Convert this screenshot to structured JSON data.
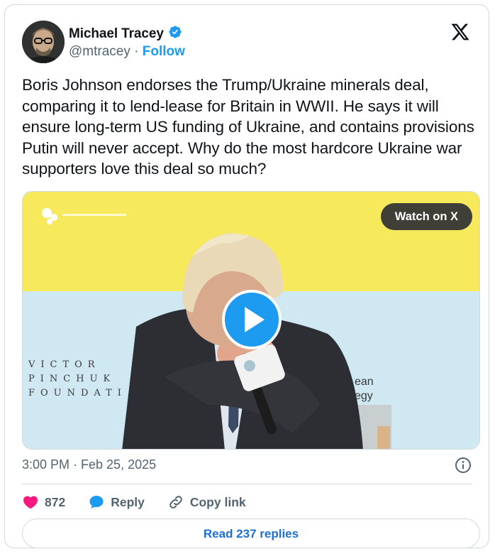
{
  "author": {
    "name": "Michael Tracey",
    "handle": "@mtracey",
    "separator": "·",
    "follow_label": "Follow",
    "verified": true
  },
  "tweet": {
    "text": "Boris Johnson endorses the Trump/Ukraine minerals deal, comparing it to lend-lease for Britain in WWII. He says it will ensure long-term US funding of Ukraine, and contains provisions Putin will never accept. Why do the most hardcore Ukraine war supporters love this deal so much?"
  },
  "media": {
    "watch_label": "Watch on X",
    "foundation_lines": [
      "VICTOR",
      "PINCHUK",
      "FOUNDATI"
    ],
    "banner_fragment_lines": [
      "ean",
      "egy"
    ]
  },
  "meta": {
    "timestamp": "3:00 PM · Feb 25, 2025"
  },
  "actions": {
    "likes_count": "872",
    "reply_label": "Reply",
    "copy_link_label": "Copy link",
    "read_replies_label": "Read 237 replies"
  },
  "colors": {
    "accent": "#1d9bf0",
    "like": "#f91880",
    "banner_yellow": "#f6ea5c",
    "banner_blue": "#cfe8f1"
  }
}
